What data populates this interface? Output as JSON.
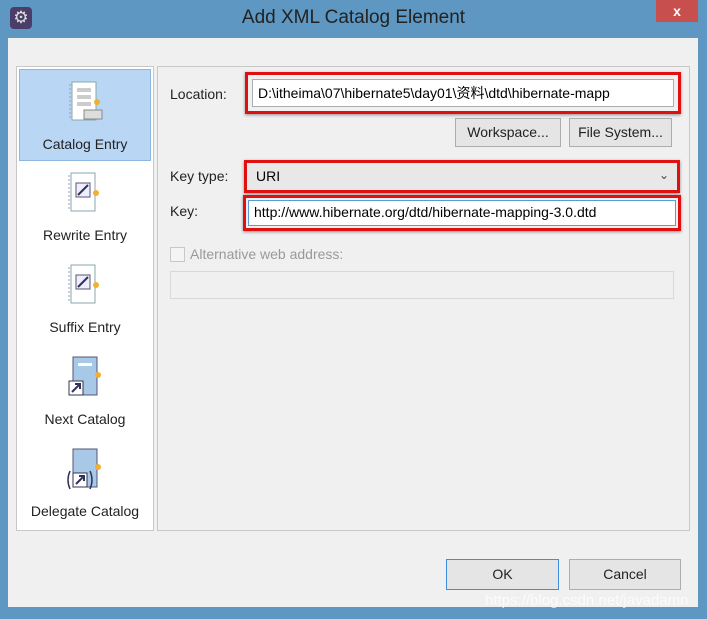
{
  "window": {
    "title": "Add XML Catalog Element",
    "close_label": "x",
    "app_icon": "gear-icon"
  },
  "sidebar": {
    "items": [
      {
        "label": "Catalog Entry",
        "icon": "catalog-entry-icon",
        "selected": true
      },
      {
        "label": "Rewrite Entry",
        "icon": "rewrite-entry-icon"
      },
      {
        "label": "Suffix Entry",
        "icon": "suffix-entry-icon"
      },
      {
        "label": "Next Catalog",
        "icon": "next-catalog-icon"
      },
      {
        "label": "Delegate Catalog",
        "icon": "delegate-catalog-icon"
      }
    ]
  },
  "form": {
    "location_label": "Location:",
    "location_value": "D:\\itheima\\07\\hibernate5\\day01\\资料\\dtd\\hibernate-mapp",
    "workspace_button": "Workspace...",
    "filesystem_button": "File System...",
    "keytype_label": "Key type:",
    "keytype_value": "URI",
    "key_label": "Key:",
    "key_value": "http://www.hibernate.org/dtd/hibernate-mapping-3.0.dtd",
    "alt_label": "Alternative web address:",
    "alt_value": ""
  },
  "footer": {
    "ok": "OK",
    "cancel": "Cancel"
  },
  "watermark": "https://blog.csdn.net/javadamn"
}
